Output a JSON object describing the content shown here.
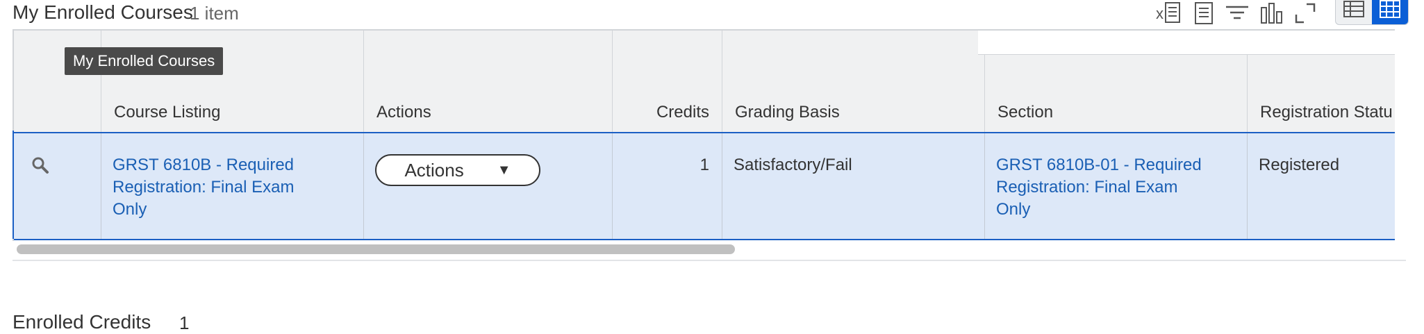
{
  "header": {
    "title": "My Enrolled Courses",
    "count": "1 item"
  },
  "toolbar": {
    "icons": [
      "excel-export-icon",
      "print-icon",
      "filter-icon",
      "chart-icon",
      "fullscreen-icon"
    ],
    "view_options": [
      "table-view-icon",
      "grid-view-icon"
    ],
    "active_view": "grid-view-icon",
    "accent_color": "#0b5fd6"
  },
  "tooltip": "My Enrolled Courses",
  "table": {
    "columns": [
      "",
      "Course Listing",
      "Actions",
      "Credits",
      "Grading Basis",
      "Section",
      "Registration Statu"
    ],
    "row": {
      "course_listing": [
        "GRST 6810B - Required",
        "Registration: Final Exam",
        "Only"
      ],
      "actions_label": "Actions",
      "credits": "1",
      "grading_basis": "Satisfactory/Fail",
      "section": [
        "GRST 6810B-01 - Required",
        "Registration: Final Exam",
        "Only"
      ],
      "registration_status": "Registered"
    },
    "selected_row_color": "#dde8f8",
    "link_color": "#1a5fb4"
  },
  "footer": {
    "label": "Enrolled Credits",
    "value": "1"
  }
}
